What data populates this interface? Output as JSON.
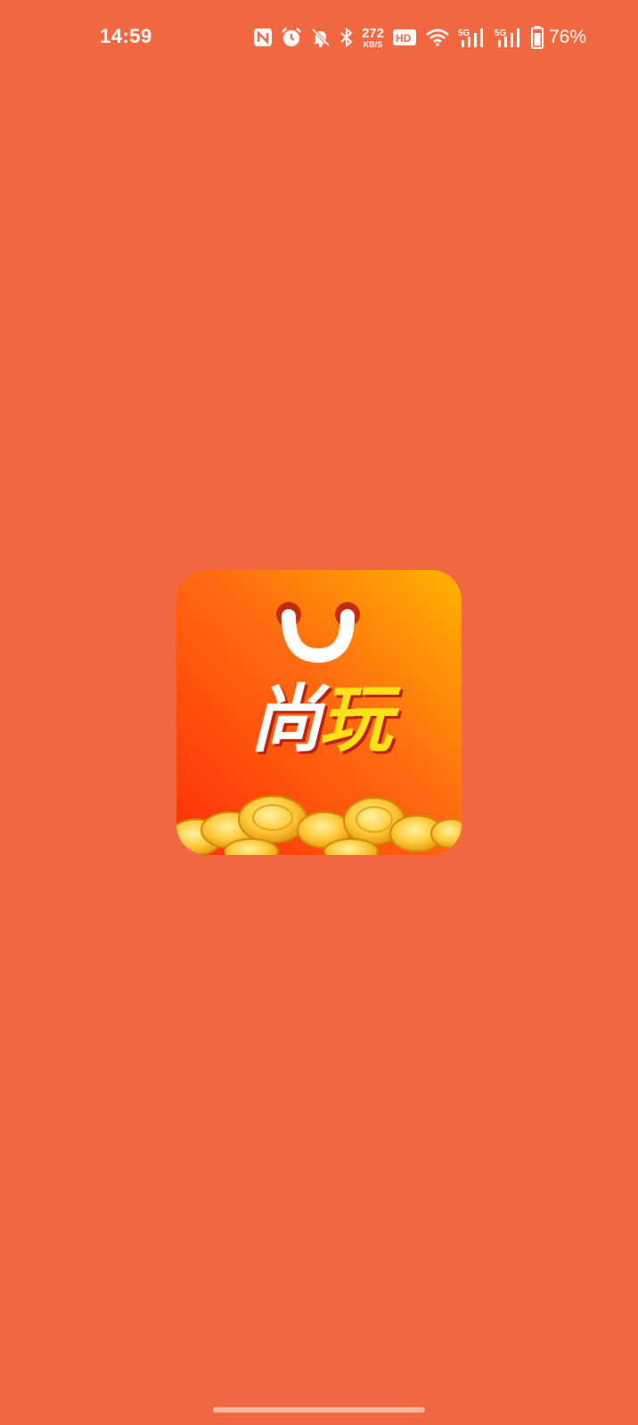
{
  "status_bar": {
    "time": "14:59",
    "net_speed_value": "272",
    "net_speed_unit": "KB/S",
    "hd_label": "HD",
    "signal1_label": "5G",
    "signal2_label": "5G",
    "battery_percent": "76%",
    "icons": [
      "nfc-icon",
      "alarm-icon",
      "bell-off-icon",
      "bluetooth-icon",
      "hd-voice-icon",
      "wifi-icon",
      "signal-icon",
      "signal-icon",
      "battery-icon"
    ]
  },
  "splash": {
    "logo_char_1": "尚",
    "logo_char_2": "玩",
    "background_color": "#F06740"
  }
}
